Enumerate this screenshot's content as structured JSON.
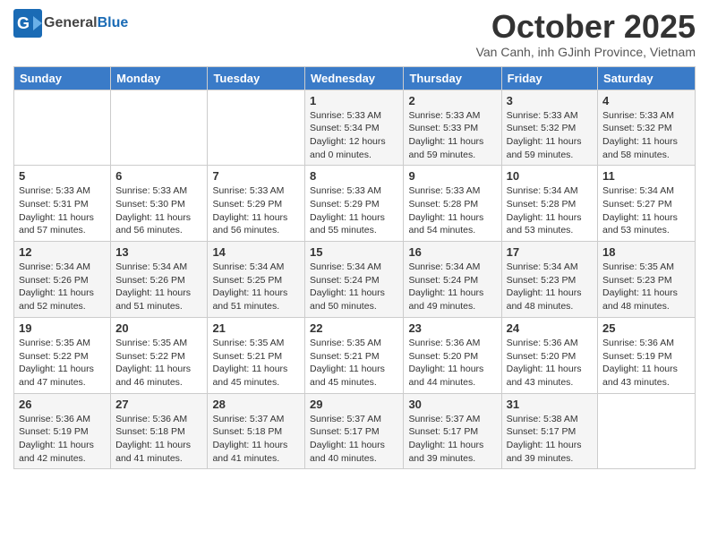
{
  "logo": {
    "general": "General",
    "blue": "Blue"
  },
  "header": {
    "month": "October 2025",
    "location": "Van Canh, inh GJinh Province, Vietnam"
  },
  "weekdays": [
    "Sunday",
    "Monday",
    "Tuesday",
    "Wednesday",
    "Thursday",
    "Friday",
    "Saturday"
  ],
  "weeks": [
    [
      {
        "day": "",
        "info": ""
      },
      {
        "day": "",
        "info": ""
      },
      {
        "day": "",
        "info": ""
      },
      {
        "day": "1",
        "info": "Sunrise: 5:33 AM\nSunset: 5:34 PM\nDaylight: 12 hours\nand 0 minutes."
      },
      {
        "day": "2",
        "info": "Sunrise: 5:33 AM\nSunset: 5:33 PM\nDaylight: 11 hours\nand 59 minutes."
      },
      {
        "day": "3",
        "info": "Sunrise: 5:33 AM\nSunset: 5:32 PM\nDaylight: 11 hours\nand 59 minutes."
      },
      {
        "day": "4",
        "info": "Sunrise: 5:33 AM\nSunset: 5:32 PM\nDaylight: 11 hours\nand 58 minutes."
      }
    ],
    [
      {
        "day": "5",
        "info": "Sunrise: 5:33 AM\nSunset: 5:31 PM\nDaylight: 11 hours\nand 57 minutes."
      },
      {
        "day": "6",
        "info": "Sunrise: 5:33 AM\nSunset: 5:30 PM\nDaylight: 11 hours\nand 56 minutes."
      },
      {
        "day": "7",
        "info": "Sunrise: 5:33 AM\nSunset: 5:29 PM\nDaylight: 11 hours\nand 56 minutes."
      },
      {
        "day": "8",
        "info": "Sunrise: 5:33 AM\nSunset: 5:29 PM\nDaylight: 11 hours\nand 55 minutes."
      },
      {
        "day": "9",
        "info": "Sunrise: 5:33 AM\nSunset: 5:28 PM\nDaylight: 11 hours\nand 54 minutes."
      },
      {
        "day": "10",
        "info": "Sunrise: 5:34 AM\nSunset: 5:28 PM\nDaylight: 11 hours\nand 53 minutes."
      },
      {
        "day": "11",
        "info": "Sunrise: 5:34 AM\nSunset: 5:27 PM\nDaylight: 11 hours\nand 53 minutes."
      }
    ],
    [
      {
        "day": "12",
        "info": "Sunrise: 5:34 AM\nSunset: 5:26 PM\nDaylight: 11 hours\nand 52 minutes."
      },
      {
        "day": "13",
        "info": "Sunrise: 5:34 AM\nSunset: 5:26 PM\nDaylight: 11 hours\nand 51 minutes."
      },
      {
        "day": "14",
        "info": "Sunrise: 5:34 AM\nSunset: 5:25 PM\nDaylight: 11 hours\nand 51 minutes."
      },
      {
        "day": "15",
        "info": "Sunrise: 5:34 AM\nSunset: 5:24 PM\nDaylight: 11 hours\nand 50 minutes."
      },
      {
        "day": "16",
        "info": "Sunrise: 5:34 AM\nSunset: 5:24 PM\nDaylight: 11 hours\nand 49 minutes."
      },
      {
        "day": "17",
        "info": "Sunrise: 5:34 AM\nSunset: 5:23 PM\nDaylight: 11 hours\nand 48 minutes."
      },
      {
        "day": "18",
        "info": "Sunrise: 5:35 AM\nSunset: 5:23 PM\nDaylight: 11 hours\nand 48 minutes."
      }
    ],
    [
      {
        "day": "19",
        "info": "Sunrise: 5:35 AM\nSunset: 5:22 PM\nDaylight: 11 hours\nand 47 minutes."
      },
      {
        "day": "20",
        "info": "Sunrise: 5:35 AM\nSunset: 5:22 PM\nDaylight: 11 hours\nand 46 minutes."
      },
      {
        "day": "21",
        "info": "Sunrise: 5:35 AM\nSunset: 5:21 PM\nDaylight: 11 hours\nand 45 minutes."
      },
      {
        "day": "22",
        "info": "Sunrise: 5:35 AM\nSunset: 5:21 PM\nDaylight: 11 hours\nand 45 minutes."
      },
      {
        "day": "23",
        "info": "Sunrise: 5:36 AM\nSunset: 5:20 PM\nDaylight: 11 hours\nand 44 minutes."
      },
      {
        "day": "24",
        "info": "Sunrise: 5:36 AM\nSunset: 5:20 PM\nDaylight: 11 hours\nand 43 minutes."
      },
      {
        "day": "25",
        "info": "Sunrise: 5:36 AM\nSunset: 5:19 PM\nDaylight: 11 hours\nand 43 minutes."
      }
    ],
    [
      {
        "day": "26",
        "info": "Sunrise: 5:36 AM\nSunset: 5:19 PM\nDaylight: 11 hours\nand 42 minutes."
      },
      {
        "day": "27",
        "info": "Sunrise: 5:36 AM\nSunset: 5:18 PM\nDaylight: 11 hours\nand 41 minutes."
      },
      {
        "day": "28",
        "info": "Sunrise: 5:37 AM\nSunset: 5:18 PM\nDaylight: 11 hours\nand 41 minutes."
      },
      {
        "day": "29",
        "info": "Sunrise: 5:37 AM\nSunset: 5:17 PM\nDaylight: 11 hours\nand 40 minutes."
      },
      {
        "day": "30",
        "info": "Sunrise: 5:37 AM\nSunset: 5:17 PM\nDaylight: 11 hours\nand 39 minutes."
      },
      {
        "day": "31",
        "info": "Sunrise: 5:38 AM\nSunset: 5:17 PM\nDaylight: 11 hours\nand 39 minutes."
      },
      {
        "day": "",
        "info": ""
      }
    ]
  ]
}
